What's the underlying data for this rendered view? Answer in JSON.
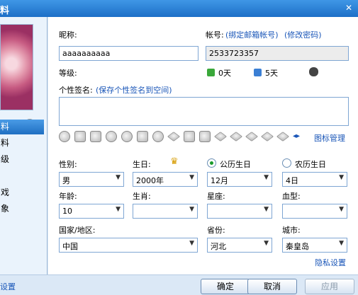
{
  "window": {
    "title_fragment": "料",
    "close_glyph": "✕"
  },
  "sidebar": {
    "head_label": "头像",
    "items": [
      {
        "label": "料"
      },
      {
        "label": "料"
      },
      {
        "label": "级"
      },
      {
        "label": "戏"
      },
      {
        "label": "象"
      }
    ]
  },
  "form": {
    "nickname_label": "昵称:",
    "nickname_value": "aaaaaaaaaa",
    "account_label": "帐号:",
    "bind_email_link": "(绑定邮箱帐号)",
    "change_pwd_link": "(修改密码)",
    "account_value": "2533723357",
    "level_label": "等级:",
    "level_days_1": "0天",
    "level_days_2": "5天",
    "signature_label": "个性签名:",
    "save_signature_link": "(保存个性签名到空间)",
    "icon_manage_link": "图标管理",
    "gender_label": "性别:",
    "gender_value": "男",
    "birthday_label": "生日:",
    "solar_label": "公历生日",
    "lunar_label": "农历生日",
    "year_value": "2000年",
    "month_value": "12月",
    "day_value": "4日",
    "age_label": "年龄:",
    "age_value": "10",
    "zodiac_label": "生肖:",
    "zodiac_value": "",
    "constellation_label": "星座:",
    "constellation_value": "",
    "blood_label": "血型:",
    "blood_value": "",
    "country_label": "国家/地区:",
    "country_value": "中国",
    "province_label": "省份:",
    "province_value": "河北",
    "city_label": "城市:",
    "city_value": "秦皇岛",
    "privacy_link": "隐私设置"
  },
  "bottom": {
    "privacy_link": "设置",
    "ok": "确定",
    "cancel": "取消",
    "apply": "应用"
  },
  "colors": {
    "link": "#1a56b8",
    "selection": "#1f6fc2",
    "radio_dot": "#1a9b2a"
  }
}
